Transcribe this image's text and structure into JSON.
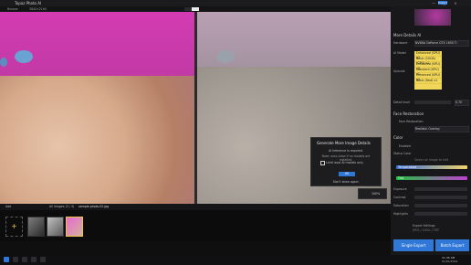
{
  "app": {
    "title": "Topaz Photo AI"
  },
  "colors": {
    "accent_blue": "#2f78d8",
    "magenta": "#d33bb3",
    "selection_yellow": "#f0d75a"
  },
  "toolbar": {
    "left_chip": "Browse",
    "image_size": "3840×2160"
  },
  "viewer": {
    "zoom": "100%"
  },
  "popup": {
    "title": "Generate More Image Details",
    "line1": "AI Inference is required.",
    "line2": "Note: auto close if no models are installed.",
    "checkbox_label": "Limit local AI models only",
    "button": "OK",
    "dont_show": "Don't show again"
  },
  "strip": {
    "add_label": "Add",
    "crumb": "All images (3 / 3)",
    "filename": "sample-photo-02.jpg"
  },
  "panel": {
    "header": "Export",
    "sections": [
      {
        "title": "More Details AI"
      },
      {
        "title": "Face Restoration"
      },
      {
        "title": "Color"
      }
    ],
    "more_details": {
      "hardware_label": "Hardware",
      "hardware_value": "NVIDIA GeForce GTX 1650 Ti",
      "ai_model_label": "AI Model",
      "ai_model_value": "Enhanced (GPU)",
      "upscale_label": "Upscale",
      "dropdown_items": [
        "Enhanced (GPU) v2",
        "Basic (CUDA) (GPU) v1",
        "Enhanced (GPU) v3",
        "Standard (GPU) v1",
        "Enhanced (GPU) v4",
        "Basic (Fast) v1"
      ],
      "detail_label": "Detail level",
      "detail_value": "0.70"
    },
    "face": {
      "enabled_label": "Face Restoration",
      "mode": "Realistic Overlay"
    },
    "color": {
      "enabled_label": "Enabled",
      "status": "Status Color",
      "note": "Select an image to edit",
      "temperature_label": "Temperature",
      "tint_label": "Tint",
      "exposure_label": "Exposure",
      "contrast_label": "Contrast",
      "saturation_label": "Saturation",
      "highlights_label": "Highlights"
    },
    "export_settings": {
      "title": "Export Settings",
      "value": "JPEG / 100% / TIFF"
    },
    "single_export": "Single Export",
    "batch_export": "Batch Export"
  },
  "taskbar": {
    "time": "11:45 AM",
    "date": "01/01/2024"
  }
}
